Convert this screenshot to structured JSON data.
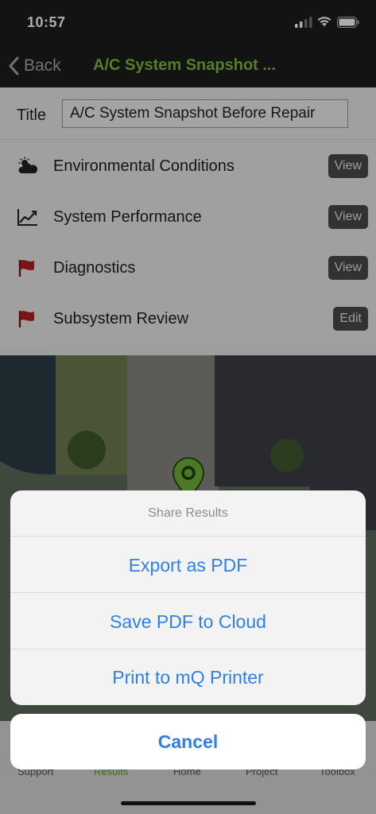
{
  "status_bar": {
    "time": "10:57"
  },
  "nav": {
    "back_label": "Back",
    "title": "A/C System Snapshot ..."
  },
  "title_row": {
    "label": "Title",
    "value": "A/C System Snapshot Before Repair"
  },
  "sections": [
    {
      "label": "Environmental Conditions",
      "icon": "weather-icon",
      "action": "View"
    },
    {
      "label": "System Performance",
      "icon": "chart-icon",
      "action": "View"
    },
    {
      "label": "Diagnostics",
      "icon": "flag-icon",
      "action": "View"
    },
    {
      "label": "Subsystem Review",
      "icon": "flag-icon",
      "action": "Edit"
    }
  ],
  "colors": {
    "accent_green": "#7dbb3a",
    "ios_blue": "#2f7fe6",
    "flag_red": "#b3201f"
  },
  "tab_bar": {
    "items": [
      {
        "label": "Support"
      },
      {
        "label": "Results"
      },
      {
        "label": "Home"
      },
      {
        "label": "Project"
      },
      {
        "label": "Toolbox"
      }
    ],
    "active": "Results"
  },
  "share_sheet": {
    "header": "Share Results",
    "options": [
      "Export as PDF",
      "Save PDF to Cloud",
      "Print to mQ Printer"
    ],
    "cancel": "Cancel"
  }
}
